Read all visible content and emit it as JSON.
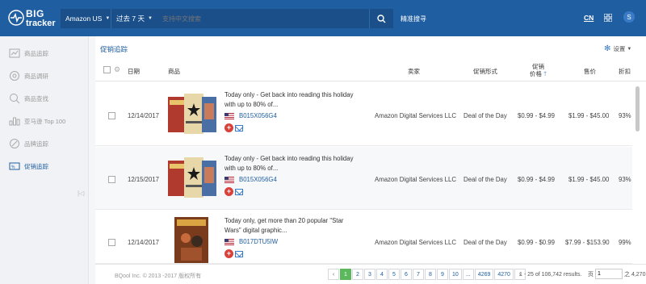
{
  "header": {
    "logo_big": "BIG",
    "logo_tracker": "tracker",
    "marketplace": "Amazon US",
    "period": "过去 7 天",
    "search_placeholder": "支持中文搜索",
    "precise_search": "精准搜寻",
    "language": "CN",
    "user_initial": "S"
  },
  "sidebar": {
    "items": [
      {
        "label": "商品追踪",
        "icon": "product-track-icon"
      },
      {
        "label": "商品调研",
        "icon": "product-research-icon"
      },
      {
        "label": "商品查找",
        "icon": "product-find-icon"
      },
      {
        "label": "亚马逊 Top 100",
        "icon": "top100-icon"
      },
      {
        "label": "品牌追踪",
        "icon": "brand-track-icon"
      },
      {
        "label": "促销追踪",
        "icon": "promo-track-icon",
        "active": true
      }
    ]
  },
  "main": {
    "title": "促销追踪",
    "settings_label": "设置",
    "columns": {
      "date": "日期",
      "product": "商品",
      "seller": "卖家",
      "promo_type": "促销形式",
      "promo_price_1": "促销",
      "promo_price_2": "价格",
      "price": "售价",
      "discount": "折扣"
    },
    "rows": [
      {
        "date": "12/14/2017",
        "title_1": "Today only - Get back into reading this holiday",
        "title_2": "with up to 80% of...",
        "asin": "B015X056G4",
        "seller": "Amazon Digital Services LLC",
        "promo_type": "Deal of the Day",
        "promo_price": "$0.99 - $4.99",
        "price": "$1.99 - $45.00",
        "discount": "93%"
      },
      {
        "date": "12/15/2017",
        "title_1": "Today only - Get back into reading this holiday",
        "title_2": "with up to 80% of...",
        "asin": "B015X056G4",
        "seller": "Amazon Digital Services LLC",
        "promo_type": "Deal of the Day",
        "promo_price": "$0.99 - $4.99",
        "price": "$1.99 - $45.00",
        "discount": "93%"
      },
      {
        "date": "12/14/2017",
        "title_1": "Today only, get more than 20 popular \"Star",
        "title_2": "Wars\" digital graphic...",
        "asin": "B017DTU5IW",
        "seller": "Amazon Digital Services LLC",
        "promo_type": "Deal of the Day",
        "promo_price": "$0.99 - $0.99",
        "price": "$7.99 - $153.90",
        "discount": "99%"
      }
    ]
  },
  "footer": {
    "copyright": "BQool Inc. © 2013 -2017 版权所有",
    "pages": [
      "1",
      "2",
      "3",
      "4",
      "5",
      "6",
      "7",
      "8",
      "9",
      "10",
      "...",
      "4269",
      "4270"
    ],
    "current_page": "1",
    "results": "1 - 25 of 106,742 results.",
    "goto_prefix": "页",
    "goto_value": "1",
    "goto_suffix": "之 4,270"
  },
  "colors": {
    "header_bg": "#1f5ea1",
    "accent": "#1f5ea1",
    "current_page": "#5cb85c",
    "add_button": "#d9413a"
  }
}
